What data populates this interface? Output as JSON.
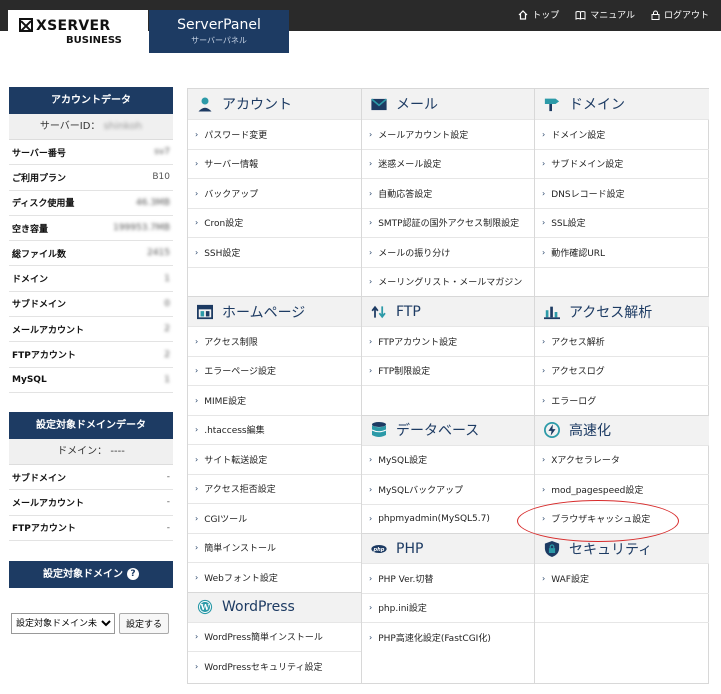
{
  "header": {
    "logo_main": "XSERVER",
    "logo_sub": "BUSINESS",
    "panel_title": "ServerPanel",
    "panel_subtitle": "サーバーパネル",
    "nav": [
      {
        "label": "トップ",
        "icon": "home-icon"
      },
      {
        "label": "マニュアル",
        "icon": "book-icon"
      },
      {
        "label": "ログアウト",
        "icon": "lock-icon"
      }
    ]
  },
  "account": {
    "title": "アカウントデータ",
    "server_id_label": "サーバーID：",
    "server_id_value": "shinkoh",
    "rows": [
      {
        "key": "サーバー番号",
        "value": "sv7",
        "masked": true
      },
      {
        "key": "ご利用プラン",
        "value": "B10",
        "masked": false
      },
      {
        "key": "ディスク使用量",
        "value": "46.3MB",
        "masked": true
      },
      {
        "key": "空き容量",
        "value": "199953.7MB",
        "masked": true
      },
      {
        "key": "総ファイル数",
        "value": "2415",
        "masked": true
      },
      {
        "key": "ドメイン",
        "value": "1",
        "masked": true
      },
      {
        "key": "サブドメイン",
        "value": "0",
        "masked": true
      },
      {
        "key": "メールアカウント",
        "value": "2",
        "masked": true
      },
      {
        "key": "FTPアカウント",
        "value": "2",
        "masked": true
      },
      {
        "key": "MySQL",
        "value": "1",
        "masked": true
      }
    ]
  },
  "domain_data": {
    "title": "設定対象ドメインデータ",
    "domain_label": "ドメイン： ----",
    "rows": [
      {
        "key": "サブドメイン",
        "value": "-"
      },
      {
        "key": "メールアカウント",
        "value": "-"
      },
      {
        "key": "FTPアカウント",
        "value": "-"
      }
    ]
  },
  "domain_select": {
    "title": "設定対象ドメイン",
    "select_value": "設定対象ドメイン未",
    "button_label": "設定する"
  },
  "columns": [
    [
      {
        "title": "アカウント",
        "icon": "person-icon",
        "items": [
          "パスワード変更",
          "サーバー情報",
          "バックアップ",
          "Cron設定",
          "SSH設定",
          ""
        ]
      },
      {
        "title": "ホームページ",
        "icon": "webpage-icon",
        "items": [
          "アクセス制限",
          "エラーページ設定",
          "MIME設定",
          ".htaccess編集",
          "サイト転送設定",
          "アクセス拒否設定",
          "CGIツール",
          "簡単インストール",
          "Webフォント設定"
        ]
      },
      {
        "title": "WordPress",
        "icon": "wordpress-icon",
        "items": [
          "WordPress簡単インストール",
          "WordPressセキュリティ設定"
        ]
      }
    ],
    [
      {
        "title": "メール",
        "icon": "mail-icon",
        "items": [
          "メールアカウント設定",
          "迷惑メール設定",
          "自動応答設定",
          "SMTP認証の国外アクセス制限設定",
          "メールの振り分け",
          "メーリングリスト・メールマガジン"
        ]
      },
      {
        "title": "FTP",
        "icon": "ftp-arrows-icon",
        "items": [
          "FTPアカウント設定",
          "FTP制限設定",
          ""
        ]
      },
      {
        "title": "データベース",
        "icon": "database-icon",
        "items": [
          "MySQL設定",
          "MySQLバックアップ",
          "phpmyadmin(MySQL5.7)"
        ]
      },
      {
        "title": "PHP",
        "icon": "php-icon",
        "items": [
          "PHP Ver.切替",
          "php.ini設定",
          "PHP高速化設定(FastCGI化)"
        ]
      }
    ],
    [
      {
        "title": "ドメイン",
        "icon": "signpost-icon",
        "items": [
          "ドメイン設定",
          "サブドメイン設定",
          "DNSレコード設定",
          "SSL設定",
          "動作確認URL",
          ""
        ]
      },
      {
        "title": "アクセス解析",
        "icon": "bar-chart-icon",
        "items": [
          "アクセス解析",
          "アクセスログ",
          "エラーログ"
        ]
      },
      {
        "title": "高速化",
        "icon": "speed-bolt-icon",
        "items": [
          "Xアクセラレータ",
          "mod_pagespeed設定",
          "ブラウザキャッシュ設定"
        ]
      },
      {
        "title": "セキュリティ",
        "icon": "shield-lock-icon",
        "items": [
          "WAF設定",
          "",
          ""
        ]
      }
    ]
  ],
  "colors": {
    "navy": "#1d3b63",
    "header_bg": "#2a2a2a",
    "highlight": "#d72a2a"
  }
}
